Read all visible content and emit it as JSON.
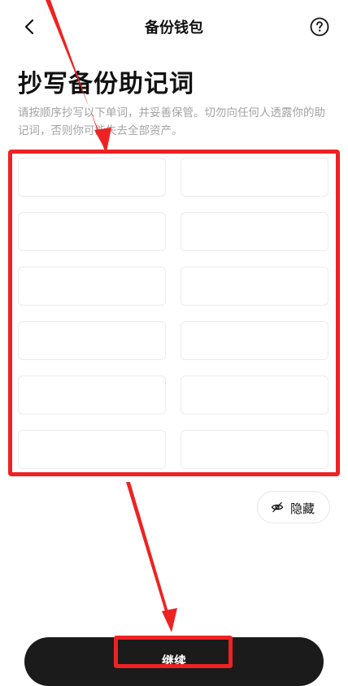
{
  "header": {
    "title": "备份钱包",
    "back_icon": "chevron-left-icon",
    "help_icon": "question-circle-icon"
  },
  "page": {
    "title": "抄写备份助记词",
    "description": "请按顺序抄写以下单词，并妥善保管。切勿向任何人透露你的助记词，否则你可能失去全部资产。"
  },
  "word_grid": {
    "slots": [
      "",
      "",
      "",
      "",
      "",
      "",
      "",
      "",
      "",
      "",
      "",
      ""
    ]
  },
  "hide_button": {
    "label": "隐藏",
    "icon": "eye-off-icon"
  },
  "continue_button": {
    "label": "继续"
  },
  "annotations": {
    "highlight_color": "#ee2222"
  }
}
